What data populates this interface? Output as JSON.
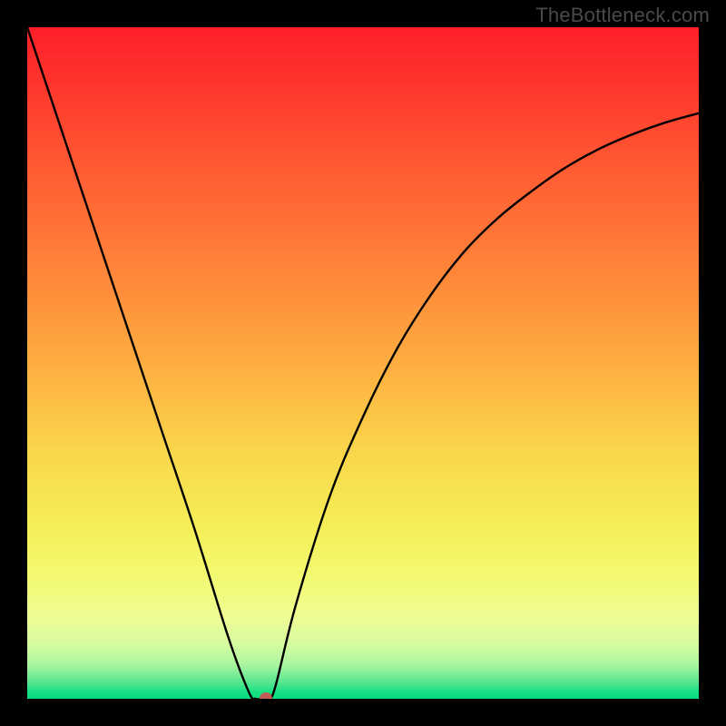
{
  "watermark": "TheBottleneck.com",
  "chart_data": {
    "type": "line",
    "title": "",
    "xlabel": "",
    "ylabel": "",
    "xlim": [
      0,
      100
    ],
    "ylim": [
      0,
      100
    ],
    "grid": false,
    "legend": false,
    "background": "rainbow-gradient-red-to-green",
    "series": [
      {
        "name": "bottleneck-curve",
        "x": [
          0,
          5,
          10,
          15,
          20,
          25,
          30,
          33,
          34,
          35,
          36,
          37,
          40,
          45,
          50,
          55,
          60,
          65,
          70,
          75,
          80,
          85,
          90,
          95,
          100
        ],
        "values": [
          100,
          85,
          70,
          55,
          40,
          25,
          9,
          1,
          0,
          0,
          0,
          2,
          14,
          30,
          42,
          52,
          60,
          66.5,
          71.5,
          75.5,
          79,
          81.8,
          84,
          85.8,
          87.2
        ]
      }
    ],
    "annotations": [
      {
        "name": "minimum-marker",
        "x": 35.5,
        "y": 0,
        "color": "#c15a54"
      }
    ]
  }
}
